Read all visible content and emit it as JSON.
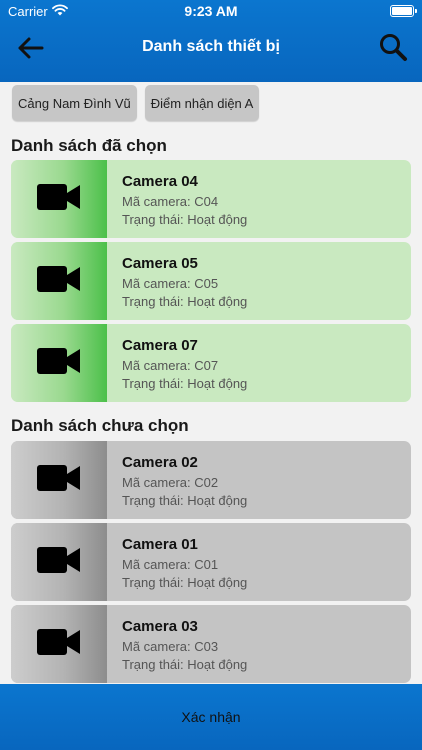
{
  "status_bar": {
    "carrier": "Carrier",
    "time": "9:23 AM"
  },
  "nav": {
    "title": "Danh sách thiết bị"
  },
  "chips": [
    {
      "label": "Cảng Nam Đình Vũ"
    },
    {
      "label": "Điểm  nhận diện A"
    }
  ],
  "sections": {
    "selected_title": "Danh sách đã chọn",
    "unselected_title": "Danh sách chưa chọn"
  },
  "labels": {
    "code": "Mã camera: ",
    "status": "Trạng thái: "
  },
  "selected": [
    {
      "name": "Camera 04",
      "code": "C04",
      "status": "Hoạt động"
    },
    {
      "name": "Camera 05",
      "code": "C05",
      "status": "Hoạt động"
    },
    {
      "name": "Camera 07",
      "code": "C07",
      "status": "Hoạt động"
    }
  ],
  "unselected": [
    {
      "name": "Camera 02",
      "code": "C02",
      "status": "Hoạt động"
    },
    {
      "name": "Camera 01",
      "code": "C01",
      "status": "Hoạt động"
    },
    {
      "name": "Camera 03",
      "code": "C03",
      "status": "Hoạt động"
    }
  ],
  "footer": {
    "confirm_label": "Xác nhận"
  },
  "colors": {
    "header_blue": "#0b76cf",
    "selected_green": "#c9e9c0",
    "unselected_gray": "#c4c4c4"
  },
  "icons": [
    "wifi-icon",
    "battery-icon",
    "back-arrow-icon",
    "search-icon",
    "video-camera-icon"
  ]
}
